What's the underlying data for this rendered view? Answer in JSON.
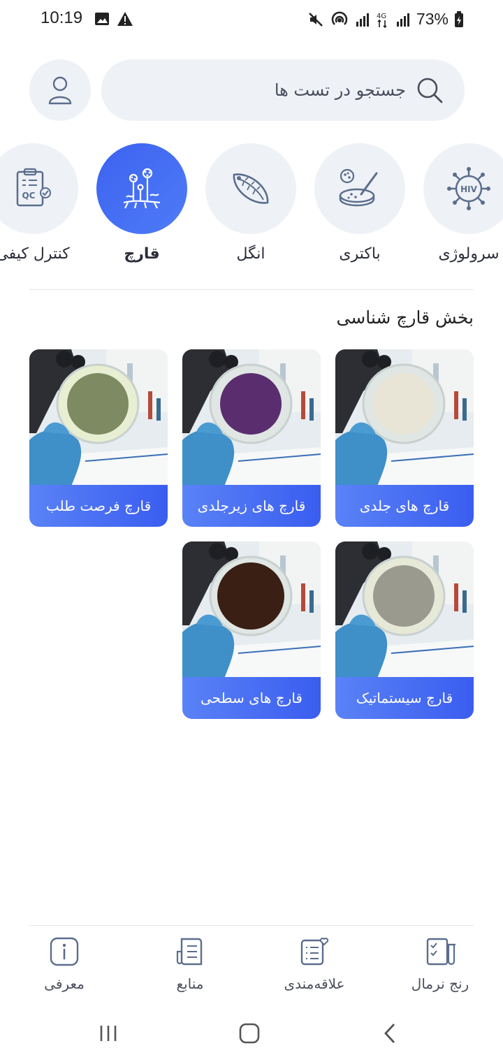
{
  "status": {
    "time": "10:19",
    "battery": "73%",
    "network": "4G"
  },
  "search": {
    "placeholder": "جستجو در تست ها"
  },
  "categories": [
    {
      "label": "سرولوژی",
      "icon": "hiv-virus-icon",
      "active": false
    },
    {
      "label": "باکتری",
      "icon": "petri-dish-icon",
      "active": false
    },
    {
      "label": "انگل",
      "icon": "parasite-icon",
      "active": false
    },
    {
      "label": "قارچ",
      "icon": "fungus-icon",
      "active": true
    },
    {
      "label": "کنترل کیفی",
      "icon": "qc-clipboard-icon",
      "active": false
    }
  ],
  "category_icon_text": {
    "hiv": "HIV",
    "qc": "QC"
  },
  "section": {
    "title": "بخش قارچ شناسی"
  },
  "cards": [
    {
      "label": "قارچ های جلدی",
      "colony_color": "#e8e4d6"
    },
    {
      "label": "قارچ های زیرجلدی",
      "colony_color": "#5a2e6e"
    },
    {
      "label": "قارچ فرصت طلب",
      "colony_color": "#7d8a62"
    },
    {
      "label": "قارچ سیستماتیک",
      "colony_color": "#9a9a8e"
    },
    {
      "label": "قارچ های سطحی",
      "colony_color": "#3a1f14"
    }
  ],
  "bottom_nav": [
    {
      "label": "رنج نرمال",
      "icon": "checklist-tube-icon"
    },
    {
      "label": "علاقه‌مندی",
      "icon": "favorites-list-icon"
    },
    {
      "label": "منابع",
      "icon": "references-icon"
    },
    {
      "label": "معرفی",
      "icon": "info-icon"
    }
  ],
  "colors": {
    "accent": "#3c62f0",
    "chip_bg": "#eef1f6",
    "text": "#2b2d3a"
  }
}
